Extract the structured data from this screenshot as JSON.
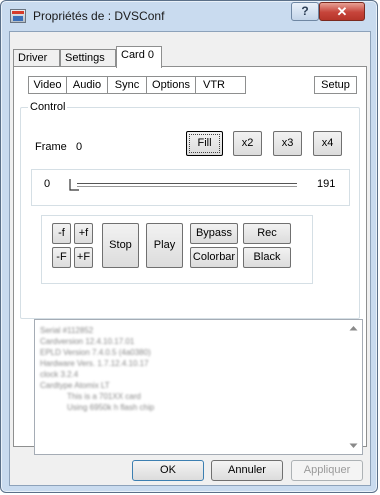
{
  "window": {
    "title": "Propriétés de : DVSConf",
    "help_label": "?",
    "close_label": "✕"
  },
  "tabs": [
    "Driver",
    "Settings",
    "Card 0"
  ],
  "subtabs": [
    "Video",
    "Audio",
    "Sync",
    "Options",
    "VTR"
  ],
  "setup_label": "Setup",
  "control": {
    "group_label": "Control",
    "frame_label": "Frame",
    "frame_value": "0",
    "fill_label": "Fill",
    "zoom_buttons": [
      "x2",
      "x3",
      "x4"
    ],
    "slider_min": "0",
    "slider_max": "191"
  },
  "transport": {
    "minus_f": "-f",
    "plus_f": "+f",
    "minus_F": "-F",
    "plus_F": "+F",
    "stop": "Stop",
    "play": "Play",
    "bypass": "Bypass",
    "rec": "Rec",
    "colorbar": "Colorbar",
    "black": "Black"
  },
  "log_lines": [
    "Serial #112852",
    "Cardversion 12.4.10.17.01",
    "EPLD Version 7.4.0.5 (4a0380)",
    "Hardware Vers. 1.7.12.4.10.17",
    "clock 3.2.4",
    "Cardtype Atomix LT",
    "This is a 701XX card",
    "Using 6950k h flash chip"
  ],
  "dialog": {
    "ok": "OK",
    "cancel": "Annuler",
    "apply": "Appliquer"
  }
}
